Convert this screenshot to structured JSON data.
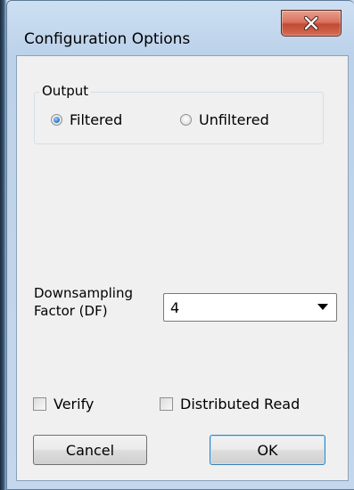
{
  "window": {
    "title": "Configuration Options"
  },
  "output_group": {
    "legend": "Output",
    "options": [
      {
        "label": "Filtered",
        "checked": true
      },
      {
        "label": "Unfiltered",
        "checked": false
      }
    ]
  },
  "downsampling": {
    "label_line1": "Downsampling",
    "label_line2": "Factor (DF)",
    "value": "4"
  },
  "checkboxes": {
    "verify": {
      "label": "Verify",
      "checked": false
    },
    "distributed_read": {
      "label": "Distributed Read",
      "checked": false
    }
  },
  "buttons": {
    "cancel": "Cancel",
    "ok": "OK"
  },
  "colors": {
    "close_button": "#c9503a",
    "frame": "#bcd2ea",
    "client_bg": "#f0f0f0",
    "radio_selected": "#2f7fd1"
  },
  "icons": {
    "close": "close-icon",
    "dropdown": "chevron-down-icon"
  }
}
